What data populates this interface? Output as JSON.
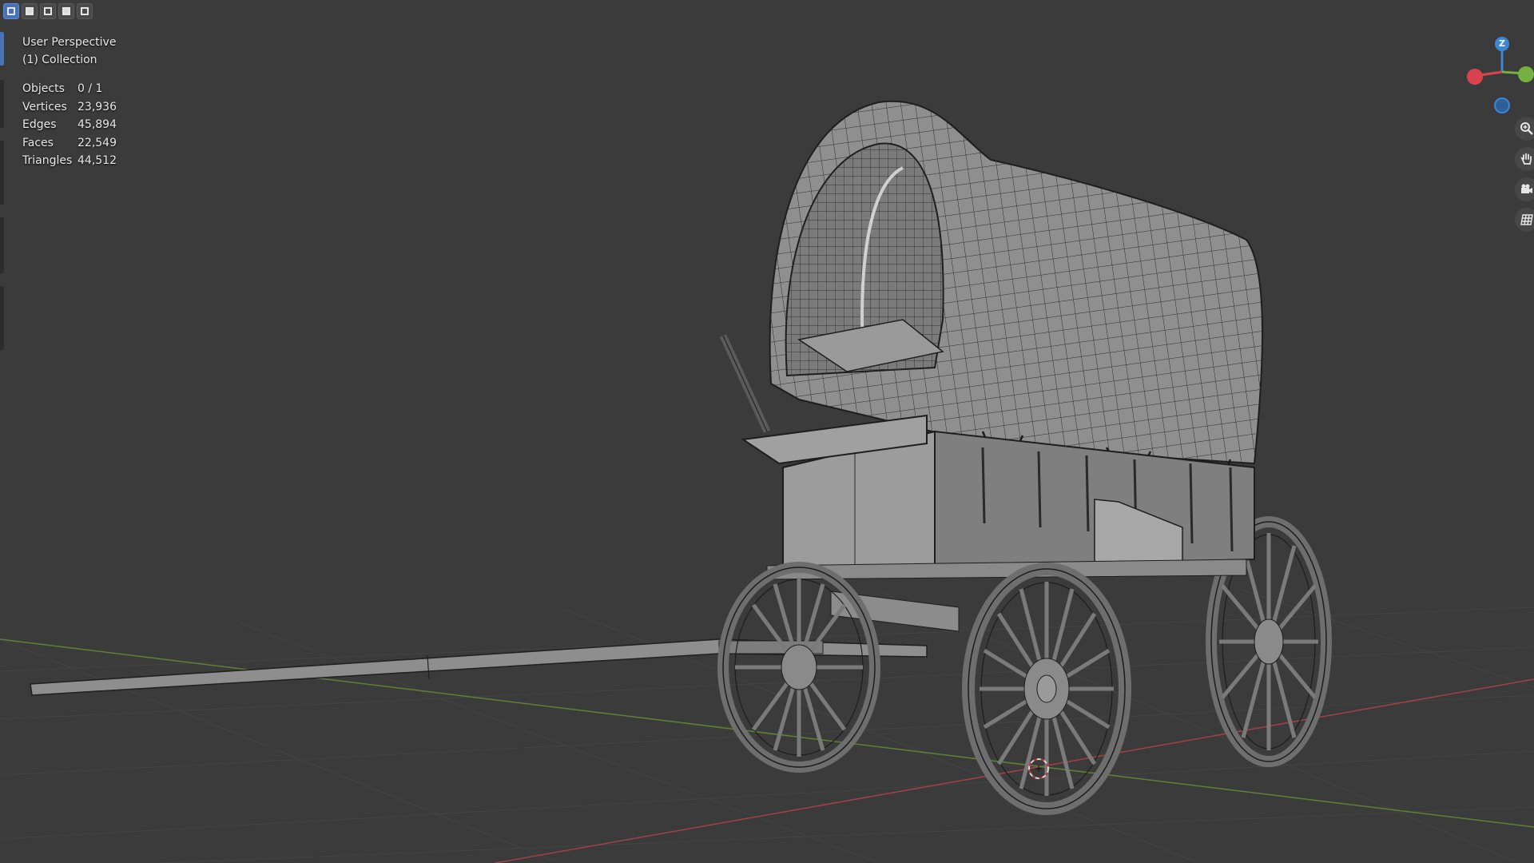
{
  "viewport": {
    "view_name": "User Perspective",
    "collection": "(1) Collection"
  },
  "stats": [
    {
      "label": "Objects",
      "value": "0 / 1"
    },
    {
      "label": "Vertices",
      "value": "23,936"
    },
    {
      "label": "Edges",
      "value": "45,894"
    },
    {
      "label": "Faces",
      "value": "22,549"
    },
    {
      "label": "Triangles",
      "value": "44,512"
    }
  ],
  "selection_modes": [
    "select-new-icon",
    "select-extend-icon",
    "select-subtract-icon",
    "select-invert-icon",
    "select-intersect-icon"
  ],
  "gizmo": {
    "z_label": "Z",
    "x_color": "#d9434f",
    "y_color": "#76b043",
    "z_color": "#3d86d6"
  },
  "nav_buttons": [
    "zoom-icon",
    "pan-hand-icon",
    "camera-view-icon",
    "ortho-grid-icon"
  ],
  "colors": {
    "background": "#3b3b3b",
    "accent": "#4772b3",
    "x_axis": "#b5434b",
    "y_axis": "#6a8c3a"
  }
}
